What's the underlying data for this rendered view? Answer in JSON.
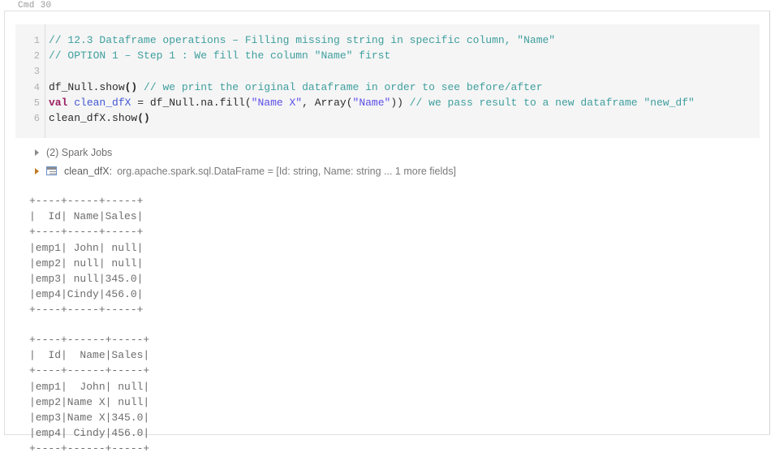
{
  "cell": {
    "label": "Cmd 30"
  },
  "editor": {
    "lines": [
      {
        "n": "1",
        "tokens": [
          {
            "t": "comment",
            "v": "// 12.3 Dataframe operations – Filling missing string in specific column, \"Name\""
          }
        ]
      },
      {
        "n": "2",
        "tokens": [
          {
            "t": "comment",
            "v": "// OPTION 1 – Step 1 : We fill the column \"Name\" first"
          }
        ]
      },
      {
        "n": "3",
        "tokens": [
          {
            "t": "plain",
            "v": ""
          }
        ]
      },
      {
        "n": "4",
        "tokens": [
          {
            "t": "plain",
            "v": "df_Null.show"
          },
          {
            "t": "punct",
            "v": "()"
          },
          {
            "t": "plain",
            "v": " "
          },
          {
            "t": "comment",
            "v": "// we print the original dataframe in order to see before/after"
          }
        ]
      },
      {
        "n": "5",
        "tokens": [
          {
            "t": "keyword",
            "v": "val"
          },
          {
            "t": "plain",
            "v": " "
          },
          {
            "t": "ident",
            "v": "clean_dfX"
          },
          {
            "t": "plain",
            "v": " = df_Null.na.fill("
          },
          {
            "t": "string",
            "v": "\"Name X\""
          },
          {
            "t": "plain",
            "v": ", Array("
          },
          {
            "t": "string",
            "v": "\"Name\""
          },
          {
            "t": "plain",
            "v": ")) "
          },
          {
            "t": "comment",
            "v": "// we pass result to a new dataframe \"new_df\""
          }
        ]
      },
      {
        "n": "6",
        "tokens": [
          {
            "t": "plain",
            "v": "clean_dfX.show"
          },
          {
            "t": "punct",
            "v": "()"
          }
        ]
      }
    ]
  },
  "results": {
    "spark_jobs": "(2) Spark Jobs",
    "schema_var": "clean_dfX:",
    "schema_type": "org.apache.spark.sql.DataFrame = [Id: string, Name: string ... 1 more fields]",
    "output_before": "+----+-----+-----+\n|  Id| Name|Sales|\n+----+-----+-----+\n|emp1| John| null|\n|emp2| null| null|\n|emp3| null|345.0|\n|emp4|Cindy|456.0|\n+----+-----+-----+",
    "output_after": "+----+------+-----+\n|  Id|  Name|Sales|\n+----+------+-----+\n|emp1|  John| null|\n|emp2|Name X| null|\n|emp3|Name X|345.0|\n|emp4| Cindy|456.0|\n+----+------+-----+"
  },
  "tables": {
    "before": {
      "columns": [
        "Id",
        "Name",
        "Sales"
      ],
      "rows": [
        [
          "emp1",
          "John",
          "null"
        ],
        [
          "emp2",
          "null",
          "null"
        ],
        [
          "emp3",
          "null",
          "345.0"
        ],
        [
          "emp4",
          "Cindy",
          "456.0"
        ]
      ]
    },
    "after": {
      "columns": [
        "Id",
        "Name",
        "Sales"
      ],
      "rows": [
        [
          "emp1",
          "John",
          "null"
        ],
        [
          "emp2",
          "Name X",
          "null"
        ],
        [
          "emp3",
          "Name X",
          "345.0"
        ],
        [
          "emp4",
          "Cindy",
          "456.0"
        ]
      ]
    }
  },
  "colors": {
    "editor_bg": "#f5f5f5",
    "comment": "#3f9e9e",
    "keyword": "#9c2063",
    "identifier": "#4257d4",
    "string": "#5b4ee8",
    "output_text": "#6d6d6d",
    "caret": "#c07820"
  }
}
